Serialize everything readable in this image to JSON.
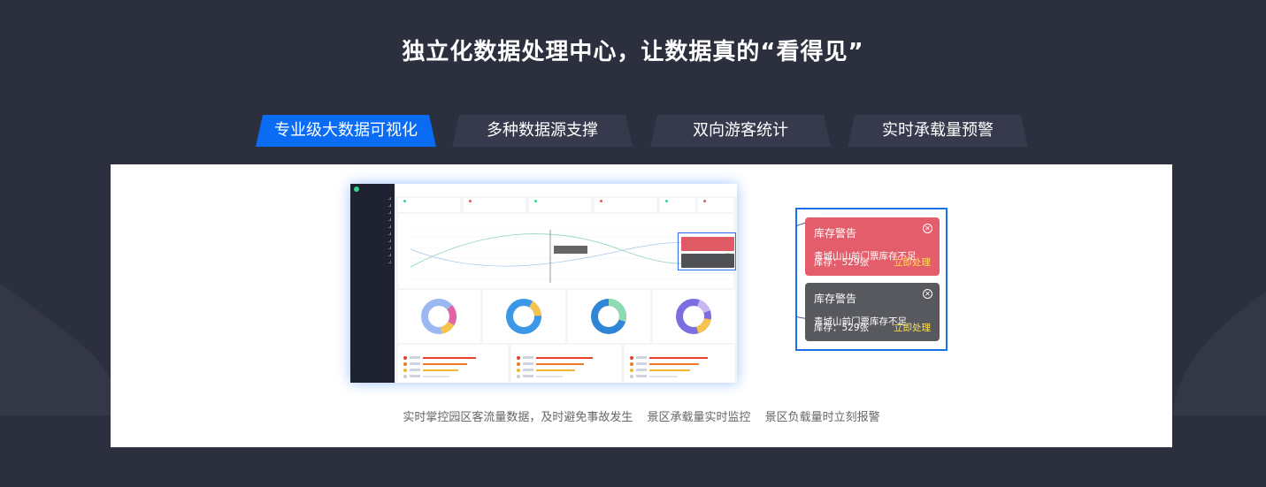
{
  "headline": "独立化数据处理中心，让数据真的“看得见”",
  "tabs": [
    {
      "label": "专业级大数据可视化",
      "active": true
    },
    {
      "label": "多种数据源支撑",
      "active": false
    },
    {
      "label": "双向游客统计",
      "active": false
    },
    {
      "label": "实时承载量预警",
      "active": false
    }
  ],
  "alerts": [
    {
      "title": "库存警告",
      "message": "青城山山前门票库存不足",
      "stock": "库存：529张",
      "action": "立即处理",
      "tone": "#e35d6a"
    },
    {
      "title": "库存警告",
      "message": "青城山前门票库存不足",
      "stock": "库存：529张",
      "action": "立即处理",
      "tone": "#57595e"
    }
  ],
  "caption": [
    "实时掌控园区客流量数据，及时避免事故发生",
    "景区承载量实时监控",
    "景区负载量时立刻报警"
  ],
  "colors": {
    "accent": "#0a6cf5",
    "background": "#2c2f3d",
    "tab_inactive": "#363a4c",
    "alert_action": "#ffe24a"
  }
}
